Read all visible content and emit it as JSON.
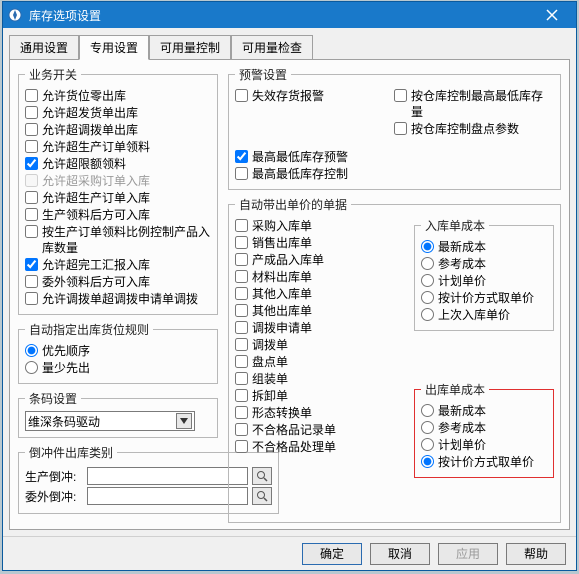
{
  "window": {
    "title": "库存选项设置"
  },
  "tabs": [
    "通用设置",
    "专用设置",
    "可用量控制",
    "可用量检查"
  ],
  "active_tab": 1,
  "biz_switch": {
    "legend": "业务开关",
    "items": [
      {
        "label": "允许货位零出库",
        "checked": false
      },
      {
        "label": "允许超发货单出库",
        "checked": false
      },
      {
        "label": "允许超调拨单出库",
        "checked": false
      },
      {
        "label": "允许超生产订单领料",
        "checked": false
      },
      {
        "label": "允许超限额领料",
        "checked": true
      },
      {
        "label": "允许超采购订单入库",
        "checked": false,
        "disabled": true
      },
      {
        "label": "允许超生产订单入库",
        "checked": false
      },
      {
        "label": "生产领料后方可入库",
        "checked": false
      },
      {
        "label": "按生产订单领料比例控制产品入库数量",
        "checked": false
      },
      {
        "label": "允许超完工汇报入库",
        "checked": true
      },
      {
        "label": "委外领料后方可入库",
        "checked": false
      },
      {
        "label": "允许调拨单超调拨申请单调拨",
        "checked": false
      }
    ]
  },
  "auto_loc": {
    "legend": "自动指定出库货位规则",
    "items": [
      {
        "label": "优先顺序",
        "checked": true
      },
      {
        "label": "量少先出",
        "checked": false
      }
    ]
  },
  "barcode": {
    "legend": "条码设置",
    "combo_value": "维深条码驱动"
  },
  "reverse": {
    "legend": "倒冲件出库类别",
    "rows": [
      {
        "label": "生产倒冲:",
        "value": ""
      },
      {
        "label": "委外倒冲:",
        "value": ""
      }
    ]
  },
  "alert": {
    "legend": "预警设置",
    "left": [
      {
        "label": "失效存货报警",
        "checked": false
      }
    ],
    "right": [
      {
        "label": "按仓库控制最高最低库存量",
        "checked": false
      },
      {
        "label": "按仓库控制盘点参数",
        "checked": false
      }
    ],
    "bottom": [
      {
        "label": "最高最低库存预警",
        "checked": true
      },
      {
        "label": "最高最低库存控制",
        "checked": false
      }
    ]
  },
  "auto_price": {
    "legend": "自动带出单价的单据",
    "docs": [
      {
        "label": "采购入库单",
        "checked": false
      },
      {
        "label": "销售出库单",
        "checked": false
      },
      {
        "label": "产成品入库单",
        "checked": false
      },
      {
        "label": "材料出库单",
        "checked": false
      },
      {
        "label": "其他入库单",
        "checked": false
      },
      {
        "label": "其他出库单",
        "checked": false
      },
      {
        "label": "调拨申请单",
        "checked": false
      },
      {
        "label": "调拨单",
        "checked": false
      },
      {
        "label": "盘点单",
        "checked": false
      },
      {
        "label": "组装单",
        "checked": false
      },
      {
        "label": "拆卸单",
        "checked": false
      },
      {
        "label": "形态转换单",
        "checked": false
      },
      {
        "label": "不合格品记录单",
        "checked": false
      },
      {
        "label": "不合格品处理单",
        "checked": false
      }
    ],
    "in_cost": {
      "legend": "入库单成本",
      "opts": [
        {
          "label": "最新成本",
          "checked": true
        },
        {
          "label": "参考成本",
          "checked": false
        },
        {
          "label": "计划单价",
          "checked": false
        },
        {
          "label": "按计价方式取单价",
          "checked": false
        },
        {
          "label": "上次入库单价",
          "checked": false
        }
      ]
    },
    "out_cost": {
      "legend": "出库单成本",
      "opts": [
        {
          "label": "最新成本",
          "checked": false
        },
        {
          "label": "参考成本",
          "checked": false
        },
        {
          "label": "计划单价",
          "checked": false
        },
        {
          "label": "按计价方式取单价",
          "checked": true
        }
      ]
    }
  },
  "buttons": {
    "ok": "确定",
    "cancel": "取消",
    "apply": "应用",
    "help": "帮助"
  }
}
